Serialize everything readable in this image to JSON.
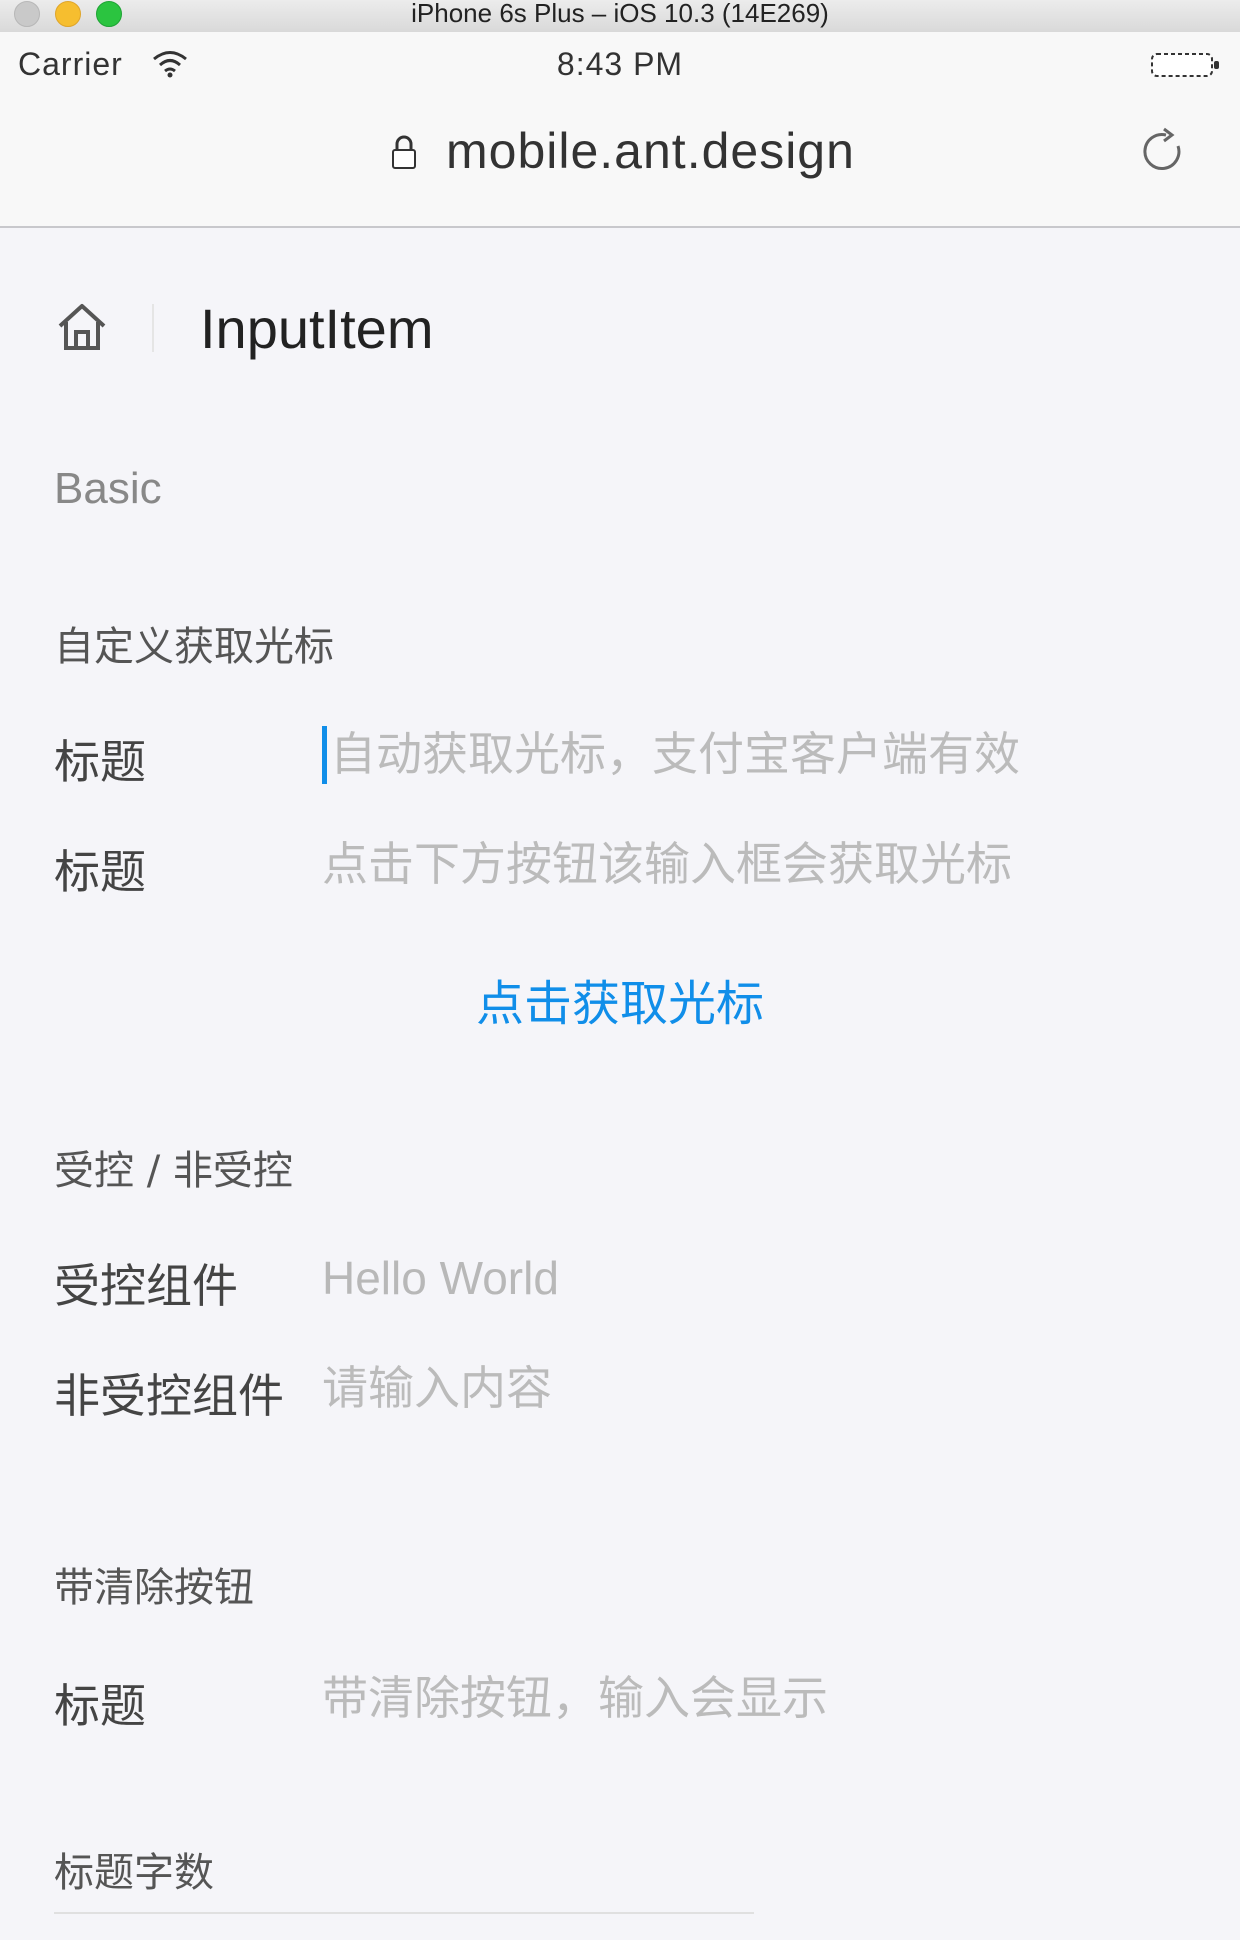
{
  "simulator": {
    "window_title": "iPhone 6s Plus – iOS 10.3 (14E269)"
  },
  "status_bar": {
    "carrier": "Carrier",
    "time": "8:43 PM"
  },
  "browser": {
    "url": "mobile.ant.design"
  },
  "nav": {
    "title": "InputItem"
  },
  "sections": {
    "basic": "Basic",
    "custom_focus": {
      "title": "自定义获取光标",
      "row1": {
        "label": "标题",
        "placeholder": "自动获取光标，支付宝客户端有效"
      },
      "row2": {
        "label": "标题",
        "placeholder": "点击下方按钮该输入框会获取光标"
      },
      "button": "点击获取光标"
    },
    "controlled": {
      "title": "受控 / 非受控",
      "row1": {
        "label": "受控组件",
        "value": "Hello World"
      },
      "row2": {
        "label": "非受控组件",
        "placeholder": "请输入内容"
      }
    },
    "clear": {
      "title": "带清除按钮",
      "row1": {
        "label": "标题",
        "placeholder": "带清除按钮，输入会显示"
      }
    },
    "title_length": {
      "title": "标题字数"
    }
  },
  "colors": {
    "background": "#f5f5f9",
    "primary": "#108ee9",
    "placeholder": "#bbbbbb"
  }
}
